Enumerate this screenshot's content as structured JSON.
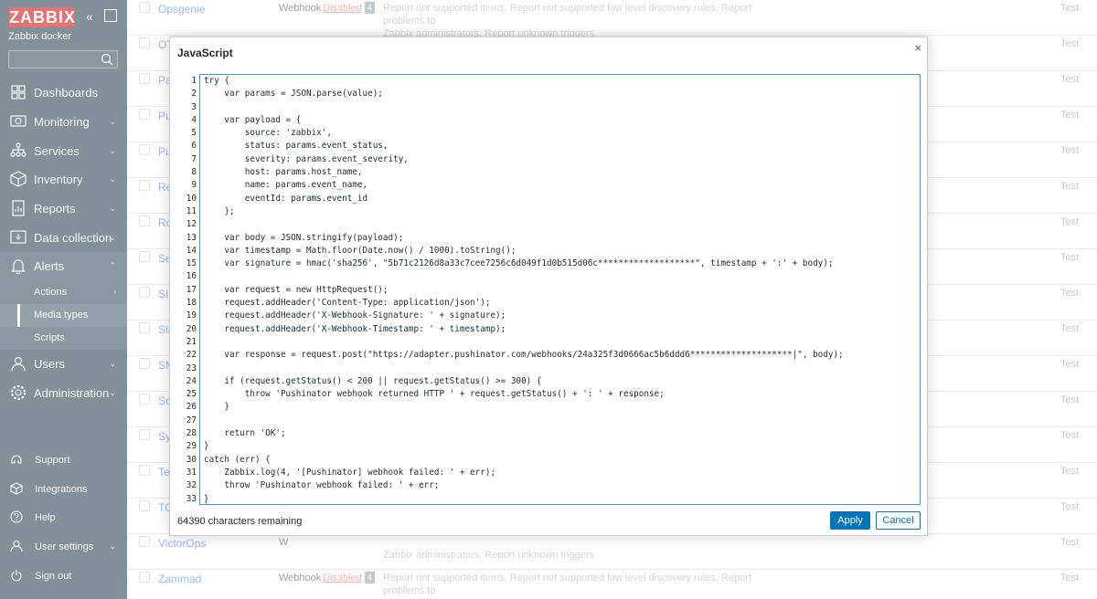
{
  "sidebar": {
    "logo_text": "ZABBIX",
    "server_name": "Zabbix docker",
    "search_placeholder": "",
    "menu": [
      {
        "label": "Dashboards",
        "icon": "dashboards-icon"
      },
      {
        "label": "Monitoring",
        "icon": "monitoring-icon",
        "has_arrow": true
      },
      {
        "label": "Services",
        "icon": "services-icon",
        "has_arrow": true
      },
      {
        "label": "Inventory",
        "icon": "inventory-icon",
        "has_arrow": true
      },
      {
        "label": "Reports",
        "icon": "reports-icon",
        "has_arrow": true
      },
      {
        "label": "Data collection",
        "icon": "data-collection-icon",
        "has_arrow": true
      },
      {
        "label": "Alerts",
        "icon": "alerts-icon",
        "has_arrow": true
      }
    ],
    "alerts_submenu": [
      {
        "label": "Actions",
        "has_arrow": true
      },
      {
        "label": "Media types",
        "selected": true
      },
      {
        "label": "Scripts"
      }
    ],
    "menu_after": [
      {
        "label": "Users",
        "icon": "users-icon",
        "has_arrow": true
      },
      {
        "label": "Administration",
        "icon": "administration-icon",
        "has_arrow": true
      }
    ],
    "bottom_menu": [
      {
        "label": "Support",
        "icon": "support-icon"
      },
      {
        "label": "Integrations",
        "icon": "integrations-icon"
      },
      {
        "label": "Help",
        "icon": "help-icon"
      },
      {
        "label": "User settings",
        "icon": "user-settings-icon",
        "has_arrow": true
      },
      {
        "label": "Sign out",
        "icon": "sign-out-icon"
      }
    ]
  },
  "table": {
    "rows": [
      {
        "name": "Opsgenie",
        "type": "Webhook",
        "status": "Disabled",
        "count": "4",
        "desc_line1": "Report not supported items, Report not supported low level discovery rules, Report problems to",
        "desc_line2": "Zabbix administrators, Report unknown triggers",
        "test": "Test"
      },
      {
        "name": "OT",
        "test": "Test"
      },
      {
        "name": "Pa",
        "test": "Test"
      },
      {
        "name": "Pu",
        "test": "Test"
      },
      {
        "name": "Pu",
        "test": "Test"
      },
      {
        "name": "Re",
        "test": "Test"
      },
      {
        "name": "Ro",
        "test": "Test"
      },
      {
        "name": "Se",
        "test": "Test"
      },
      {
        "name": "SIG",
        "test": "Test"
      },
      {
        "name": "Sla",
        "test": "Test"
      },
      {
        "name": "SM",
        "test": "Test"
      },
      {
        "name": "Sol",
        "test": "Test"
      },
      {
        "name": "Sys",
        "test": "Test"
      },
      {
        "name": "Tel",
        "test": "Test"
      },
      {
        "name": "TO",
        "test": "Test"
      },
      {
        "name": "VictorOps",
        "type": "W",
        "desc_line2": "Zabbix administrators, Report unknown triggers",
        "test": "Test"
      },
      {
        "name": "Zammad",
        "type": "Webhook",
        "status": "Disabled",
        "count": "4",
        "desc_line1": "Report not supported items, Report not supported low level discovery rules, Report problems to",
        "desc_line2": "Zabbix administrators, Report unknown triggers",
        "test": "Test"
      }
    ]
  },
  "modal": {
    "title": "JavaScript",
    "close_label": "×",
    "code_lines": [
      "try {",
      "    var params = JSON.parse(value);",
      "",
      "    var payload = {",
      "        source: 'zabbix',",
      "        status: params.event_status,",
      "        severity: params.event_severity,",
      "        host: params.host_name,",
      "        name: params.event_name,",
      "        eventId: params.event_id",
      "    };",
      "",
      "    var body = JSON.stringify(payload);",
      "    var timestamp = Math.floor(Date.now() / 1000).toString();",
      "    var signature = hmac('sha256', \"5b71c2126d8a33c7cee7256c6d049f1d0b515d06c*******************\", timestamp + ':' + body);",
      "",
      "    var request = new HttpRequest();",
      "    request.addHeader('Content-Type: application/json');",
      "    request.addHeader('X-Webhook-Signature: ' + signature);",
      "    request.addHeader('X-Webhook-Timestamp: ' + timestamp);",
      "",
      "    var response = request.post(\"https://adapter.pushinator.com/webhooks/24a325f3d0666ac5b6ddd6********************|\", body);",
      "",
      "    if (request.getStatus() < 200 || request.getStatus() >= 300) {",
      "        throw 'Pushinator webhook returned HTTP ' + request.getStatus() + ': ' + response;",
      "    }",
      "",
      "    return 'OK';",
      "}",
      "catch (err) {",
      "    Zabbix.log(4, '[Pushinator] webhook failed: ' + err);",
      "    throw 'Pushinator webhook failed: ' + err;",
      "}"
    ],
    "chars_remaining": "64390 characters remaining",
    "apply_label": "Apply",
    "cancel_label": "Cancel"
  }
}
